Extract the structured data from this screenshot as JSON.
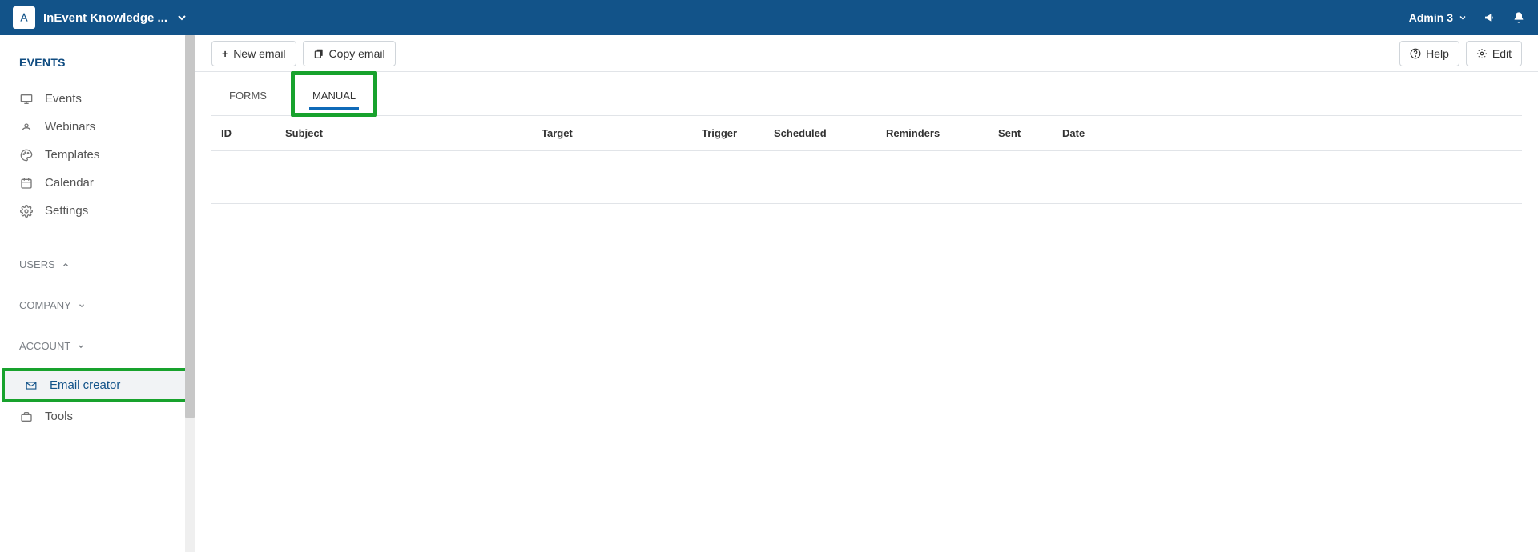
{
  "topbar": {
    "brand": "InEvent Knowledge ...",
    "user": "Admin 3"
  },
  "sidebar": {
    "events_header": "EVENTS",
    "items": [
      {
        "label": "Events"
      },
      {
        "label": "Webinars"
      },
      {
        "label": "Templates"
      },
      {
        "label": "Calendar"
      },
      {
        "label": "Settings"
      }
    ],
    "users_header": "USERS",
    "company_header": "COMPANY",
    "account_header": "ACCOUNT",
    "account_items": [
      {
        "label": "Email creator"
      },
      {
        "label": "Tools"
      }
    ]
  },
  "toolbar": {
    "new_email": "New email",
    "copy_email": "Copy email",
    "help": "Help",
    "edit": "Edit"
  },
  "tabs": {
    "forms": "FORMS",
    "manual": "MANUAL"
  },
  "table": {
    "headers": {
      "id": "ID",
      "subject": "Subject",
      "target": "Target",
      "trigger": "Trigger",
      "scheduled": "Scheduled",
      "reminders": "Reminders",
      "sent": "Sent",
      "date": "Date"
    }
  }
}
